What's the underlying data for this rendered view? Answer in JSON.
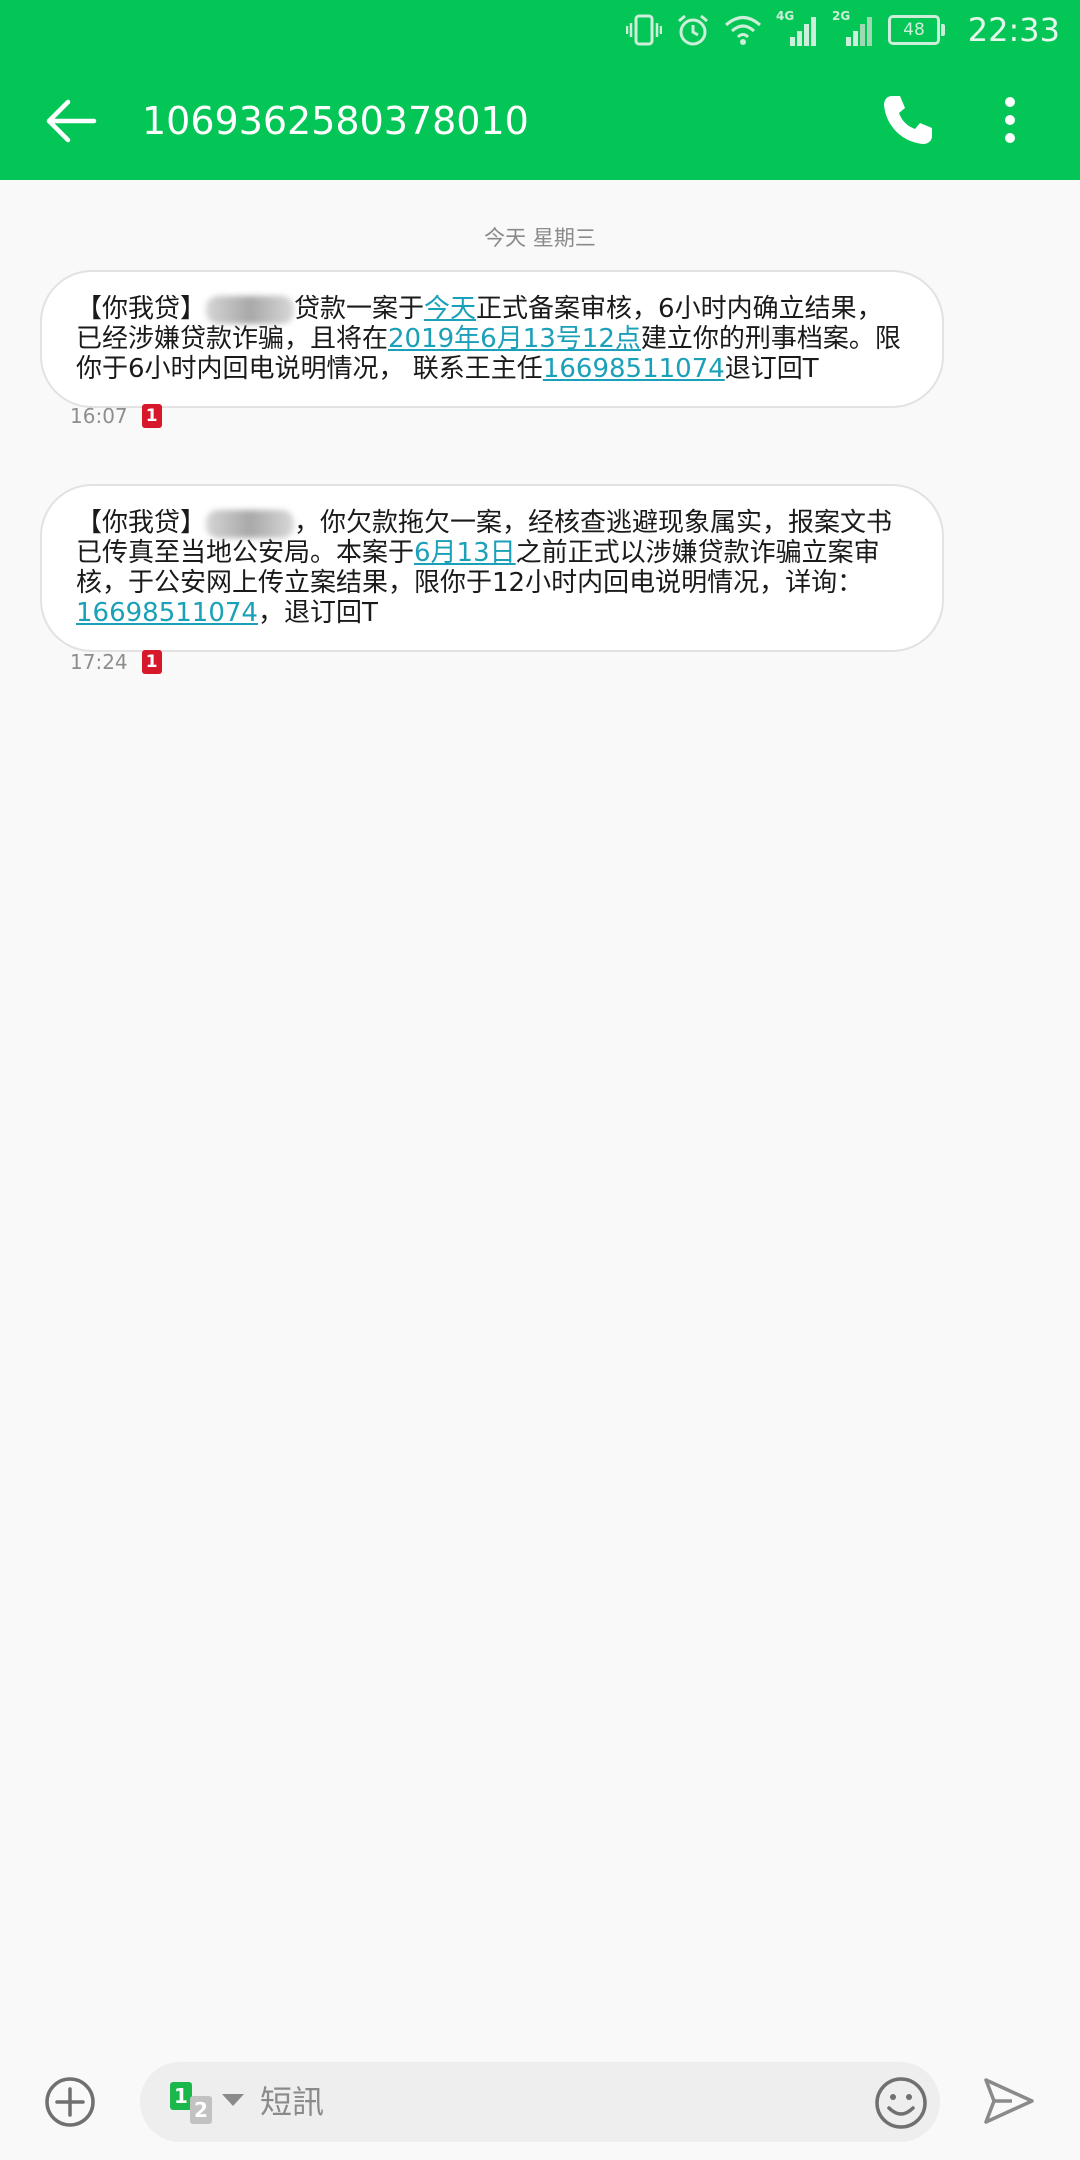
{
  "status_bar": {
    "time": "22:33",
    "battery": "48",
    "network_1": "4G",
    "network_2": "2G"
  },
  "app_bar": {
    "contact_number": "1069362580378010"
  },
  "conversation": {
    "date_header": "今天 星期三",
    "messages": [
      {
        "segments": [
          "【你我贷】",
          "贷款一案于",
          "今天",
          "正式备案审核，6小时内确立结果，已经涉嫌贷款诈骗，且将在",
          "2019年6月13号12点",
          "建立你的刑事档案。限你于6小时内回电说明情况，  联系王主任",
          "16698511074",
          "退订回T"
        ],
        "time": "16:07",
        "sim": "1"
      },
      {
        "segments": [
          "【你我贷】",
          "，你欠款拖欠一案，经核查逃避现象属实，报案文书已传真至当地公安局。本案于",
          "6月13日",
          "之前正式以涉嫌贷款诈骗立案审核，于公安网上传立案结果，限你于12小时内回电说明情况，详询：",
          "16698511074",
          "，退订回T"
        ],
        "time": "17:24",
        "sim": "1"
      }
    ]
  },
  "composer": {
    "placeholder": "短訊",
    "sim_primary": "1",
    "sim_secondary": "2"
  },
  "colors": {
    "brand_green": "#04c656",
    "link": "#1aa0b8",
    "sim_badge_red": "#d7182a"
  }
}
